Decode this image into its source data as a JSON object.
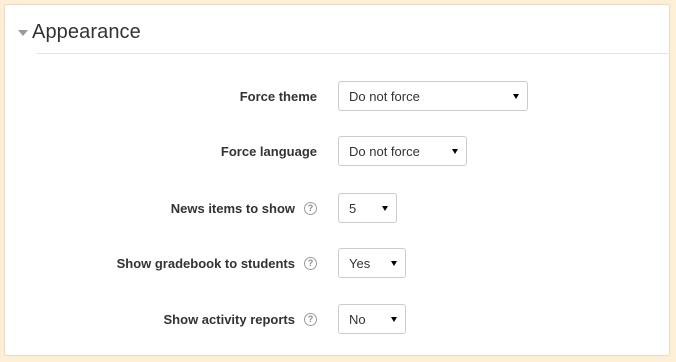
{
  "section": {
    "legend": "Appearance",
    "icon": "collapse-triangle-down"
  },
  "fields": [
    {
      "label": "Force theme",
      "help": false,
      "value": "Do not force"
    },
    {
      "label": "Force language",
      "help": false,
      "value": "Do not force"
    },
    {
      "label": "News items to show",
      "help": true,
      "value": "5"
    },
    {
      "label": "Show gradebook to students",
      "help": true,
      "value": "Yes"
    },
    {
      "label": "Show activity reports",
      "help": true,
      "value": "No"
    }
  ],
  "help_glyph": "?",
  "colors": {
    "page_background": "#fcefd6",
    "panel": "#ffffff",
    "text": "#333333"
  }
}
